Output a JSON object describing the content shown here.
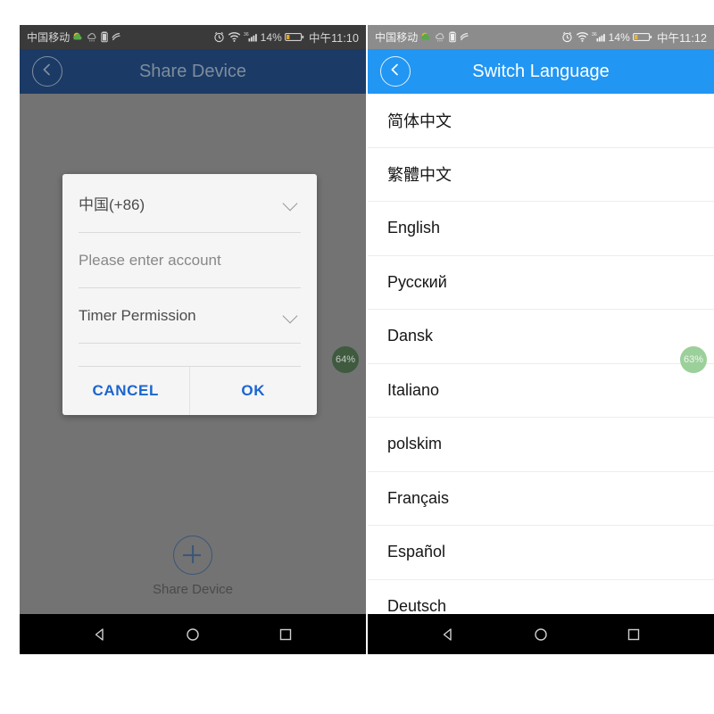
{
  "left_phone": {
    "status_bar": {
      "carrier": "中国移动",
      "battery_percent": "14%",
      "clock": "中午11:10",
      "icons": [
        "weather-icon",
        "cloud-icon",
        "battery-small-icon",
        "sync-icon",
        "alarm-icon",
        "wifi-icon",
        "signal-icon",
        "battery-icon"
      ]
    },
    "app_bar": {
      "title": "Share Device",
      "back_icon": "back-arrow-circle-icon"
    },
    "dialog": {
      "country_value": "中国(+86)",
      "country_chevron": "chevron-down-icon",
      "account_placeholder": "Please enter account",
      "permission_value": "Timer Permission",
      "permission_chevron": "chevron-down-icon",
      "cancel_label": "CANCEL",
      "ok_label": "OK"
    },
    "progress_badge": "64%",
    "footer": {
      "add_icon": "plus-circle-icon",
      "label": "Share Device"
    },
    "nav_bar": {
      "back_icon": "triangle-back-icon",
      "home_icon": "circle-home-icon",
      "recents_icon": "square-recents-icon"
    }
  },
  "right_phone": {
    "status_bar": {
      "carrier": "中国移动",
      "battery_percent": "14%",
      "clock": "中午11:12",
      "icons": [
        "weather-icon",
        "cloud-icon",
        "battery-small-icon",
        "sync-icon",
        "alarm-icon",
        "wifi-icon",
        "signal-icon",
        "battery-icon"
      ]
    },
    "app_bar": {
      "title": "Switch Language",
      "back_icon": "back-arrow-circle-icon"
    },
    "languages": [
      "简体中文",
      "繁體中文",
      "English",
      "Русский",
      "Dansk",
      "Italiano",
      "polskim",
      "Français",
      "Español",
      "Deutsch"
    ],
    "progress_badge": "63%",
    "nav_bar": {
      "back_icon": "triangle-back-icon",
      "home_icon": "circle-home-icon",
      "recents_icon": "square-recents-icon"
    }
  },
  "colors": {
    "appbar_active": "#2196f3",
    "appbar_dimmed": "#1b3a66",
    "dialog_action": "#1565d8",
    "badge_green": "#9bd09b",
    "scrim": "#737373"
  }
}
